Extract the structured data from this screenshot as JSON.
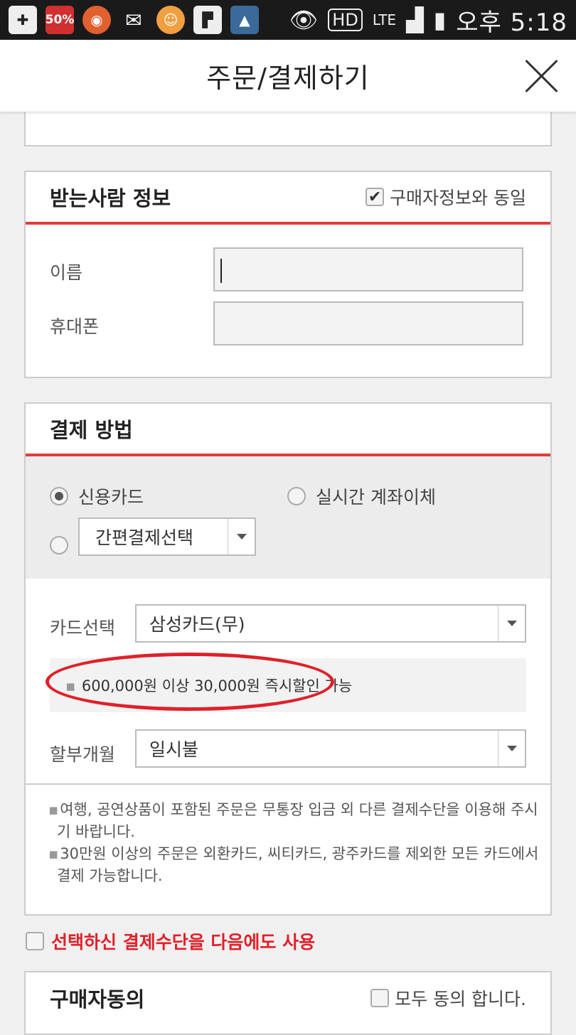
{
  "status_bar": {
    "badge_50": "50%",
    "network": "HD",
    "lte": "LTE",
    "time": "오후 5:18"
  },
  "header": {
    "title": "주문/결제하기"
  },
  "recipient": {
    "title": "받는사람 정보",
    "same_as_buyer_label": "구매자정보와 동일",
    "same_as_buyer_checked": true,
    "name_label": "이름",
    "name_value": "",
    "phone_label": "휴대폰",
    "phone_value": ""
  },
  "payment": {
    "title": "결제 방법",
    "option_credit": "신용카드",
    "option_transfer": "실시간 계좌이체",
    "easy_pay_select": "간편결제선택",
    "card_label": "카드선택",
    "card_value": "삼성카드(무)",
    "promo": "600,000원 이상 30,000원 즉시할인 가능",
    "installment_label": "할부개월",
    "installment_value": "일시불",
    "notes": [
      "여행, 공연상품이 포함된 주문은 무통장 입금 외 다른 결제수단을 이용해 주시",
      "기 바랍니다.",
      "30만원 이상의 주문은 외환카드, 씨티카드, 광주카드를 제외한 모든 카드에서",
      "결제 가능합니다."
    ]
  },
  "reuse": {
    "label": "선택하신 결제수단을 다음에도 사용"
  },
  "agreement": {
    "title": "구매자동의",
    "agree_all_label": "모두 동의 합니다."
  },
  "colors": {
    "accent": "#e03c3c",
    "annotation_circle": "#e0202a"
  }
}
